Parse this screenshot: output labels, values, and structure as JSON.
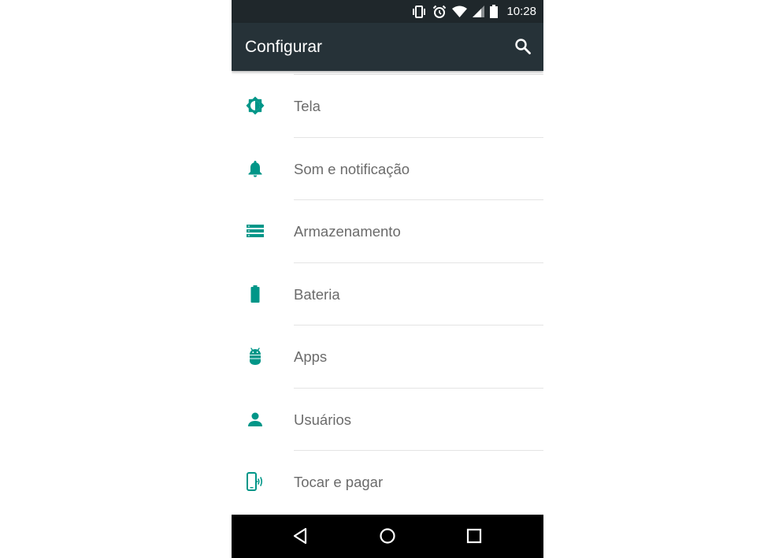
{
  "status_bar": {
    "time": "10:28",
    "icons": [
      "vibrate-icon",
      "alarm-icon",
      "wifi-icon",
      "signal-icon",
      "battery-icon"
    ]
  },
  "app_bar": {
    "title": "Configurar",
    "search_icon": "search-icon"
  },
  "colors": {
    "accent": "#009688",
    "status_bar": "#1f272b",
    "app_bar": "#263238",
    "label_text": "#6b6b6b",
    "nav_bar": "#000000"
  },
  "settings": {
    "items": [
      {
        "label": "Tela",
        "icon": "brightness-icon"
      },
      {
        "label": "Som e notificação",
        "icon": "bell-icon"
      },
      {
        "label": "Armazenamento",
        "icon": "storage-icon"
      },
      {
        "label": "Bateria",
        "icon": "battery-icon"
      },
      {
        "label": "Apps",
        "icon": "android-icon"
      },
      {
        "label": "Usuários",
        "icon": "person-icon"
      },
      {
        "label": "Tocar e pagar",
        "icon": "tap-pay-icon"
      }
    ]
  },
  "nav_bar": {
    "buttons": [
      "back-icon",
      "home-icon",
      "recents-icon"
    ]
  }
}
